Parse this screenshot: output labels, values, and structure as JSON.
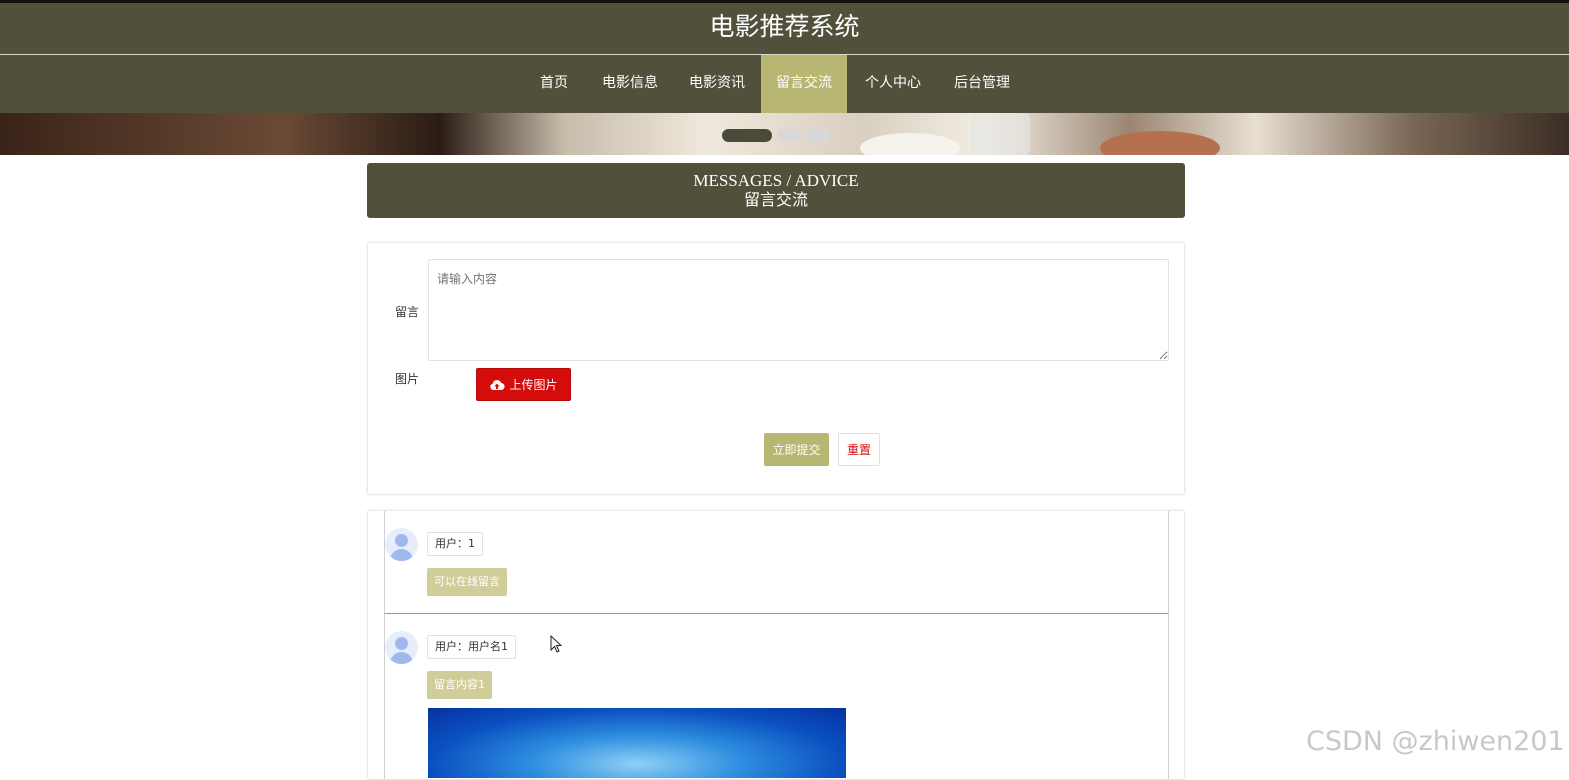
{
  "site_title": "电影推荐系统",
  "nav": {
    "items": [
      {
        "label": "首页"
      },
      {
        "label": "电影信息"
      },
      {
        "label": "电影资讯"
      },
      {
        "label": "留言交流"
      },
      {
        "label": "个人中心"
      },
      {
        "label": "后台管理"
      }
    ],
    "active_index": 3
  },
  "banner": {
    "slide_count": 3,
    "active_slide": 0
  },
  "section": {
    "title_en": "MESSAGES / ADVICE",
    "title_cn": "留言交流"
  },
  "form": {
    "message_label": "留言",
    "message_placeholder": "请输入内容",
    "image_label": "图片",
    "upload_label": "上传图片",
    "upload_icon": "cloud-upload-icon",
    "submit_label": "立即提交",
    "reset_label": "重置"
  },
  "messages": [
    {
      "user": "用户：1",
      "content": "可以在线留言"
    },
    {
      "user": "用户：用户名1",
      "content": "留言内容1"
    }
  ],
  "watermark": "CSDN @zhiwen201",
  "colors": {
    "header_bg": "#51503a",
    "accent": "#b7b672",
    "upload_red": "#d40c0c",
    "content_tag": "#cfce9a"
  }
}
